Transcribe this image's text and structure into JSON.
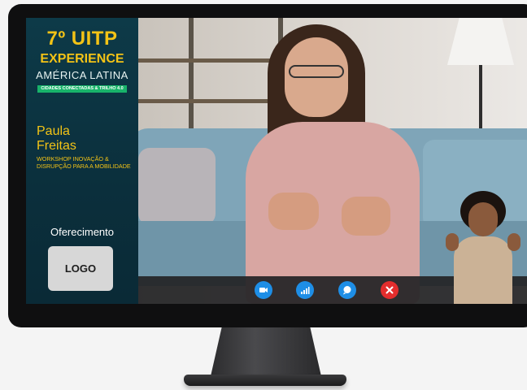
{
  "event": {
    "title_line1": "7º UITP",
    "title_line2": "EXPERIENCE",
    "region": "AMÉRICA LATINA",
    "tag": "CIDADES CONECTADAS & TRILHO 4.0"
  },
  "speaker": {
    "first_name": "Paula",
    "last_name": "Freitas",
    "role": "WORKSHOP INOVAÇÃO & DISRUPÇÃO PARA A MOBILIDADE"
  },
  "sponsor": {
    "heading": "Oferecimento",
    "logo_text": "LOGO"
  },
  "controls": [
    {
      "icon": "video-camera-icon",
      "color": "#1e8ee6"
    },
    {
      "icon": "signal-bars-icon",
      "color": "#1e8ee6"
    },
    {
      "icon": "chat-bubble-icon",
      "color": "#1e8ee6"
    },
    {
      "icon": "close-icon",
      "color": "#e32d2d"
    }
  ],
  "colors": {
    "accent_yellow": "#f3c316",
    "panel_bg": "#0d3a48",
    "tag_green": "#18b36a"
  }
}
